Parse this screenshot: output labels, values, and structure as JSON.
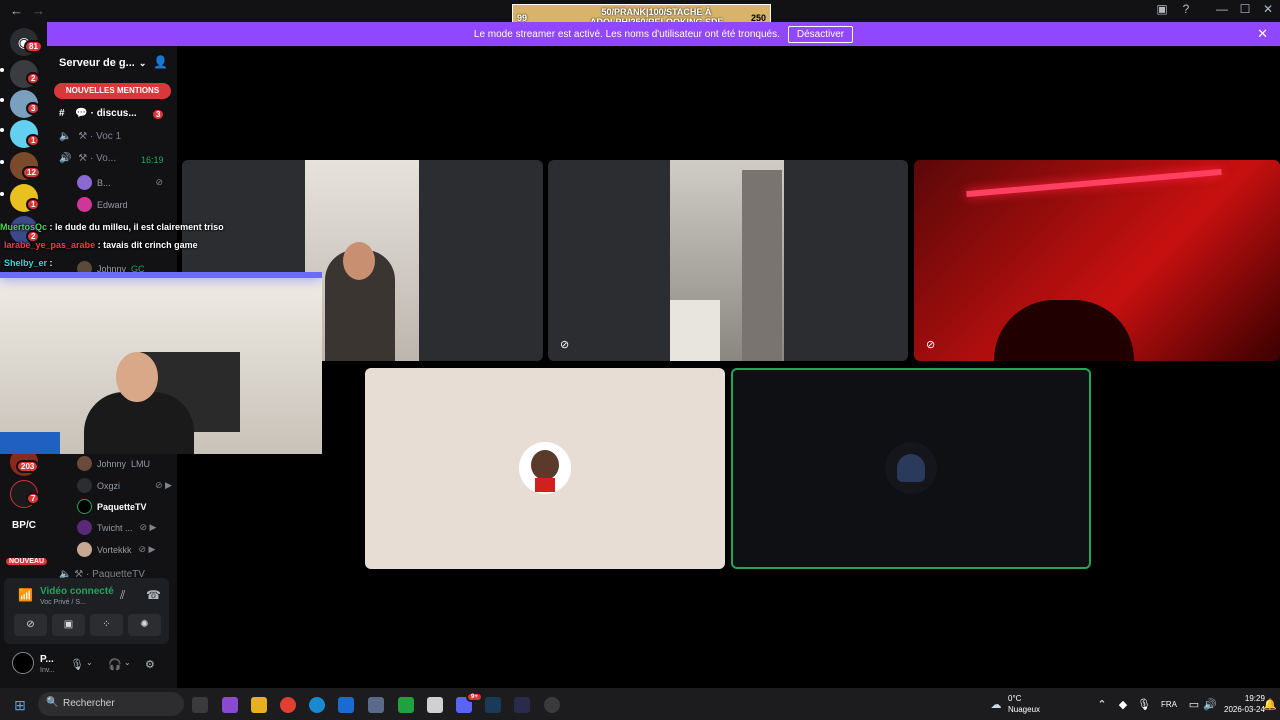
{
  "titlebar": {
    "back_icon": "arrow-left",
    "forward_icon": "arrow-right",
    "controls": [
      "inbox-icon",
      "help-icon",
      "minimize",
      "maximize",
      "close"
    ]
  },
  "stream_overlay": {
    "left_number": "99",
    "text_line1": "50/PRANK|100/STACHE À",
    "text_line2": "ADOLPH|250/RELOOKING SDF",
    "right_number": "250"
  },
  "banner": {
    "message": "Le mode streamer est activé. Les noms d'utilisateur ont été tronqués.",
    "button": "Désactiver",
    "close": "✕"
  },
  "server_rail": {
    "badges": [
      "81",
      "2",
      "3",
      "1",
      "12",
      "1",
      "2",
      "203",
      "7"
    ],
    "bpc_label": "BP/C",
    "new_label": "NOUVEAU"
  },
  "sidebar": {
    "server_name": "Serveur de g...",
    "mentions_label": "NOUVELLES MENTIONS",
    "channels": [
      {
        "name": "discus...",
        "badge": "3"
      },
      {
        "name": "Voc 1"
      },
      {
        "name": "Vo...",
        "timer": "16:19"
      }
    ],
    "users_top": [
      "B...",
      "Edward",
      "Johnny"
    ],
    "users_bottom": [
      "Johnny",
      "Oxgzi",
      "PaquetteTV",
      "Twicht ...",
      "Vortekkk"
    ],
    "johnny_tag_1": "GC",
    "johnny_tag_2": "LMU",
    "next_channel": "PaquetteTV"
  },
  "voice_panel": {
    "status": "Vidéo connecté",
    "channel": "Voc Privé / S..."
  },
  "user_panel": {
    "name": "P...",
    "status": "Inv..."
  },
  "chat_overlay": [
    {
      "user": "MuertosQc",
      "text": ": le dude du milleu, il est clairement triso",
      "color": "#4fd24f"
    },
    {
      "user": "larabe_ye_pas_arabe",
      "text": ": tavais dit crinch game",
      "color": "#ff3b3b"
    },
    {
      "user": "Shelby_er",
      "text": ":",
      "color": "#3ad6e0"
    }
  ],
  "taskbar": {
    "search_placeholder": "Rechercher",
    "discord_badge": "9+",
    "weather_temp": "0°C",
    "weather_desc": "Nuageux",
    "language": "FRA",
    "time": "19:29",
    "date": "2026-03-24"
  }
}
